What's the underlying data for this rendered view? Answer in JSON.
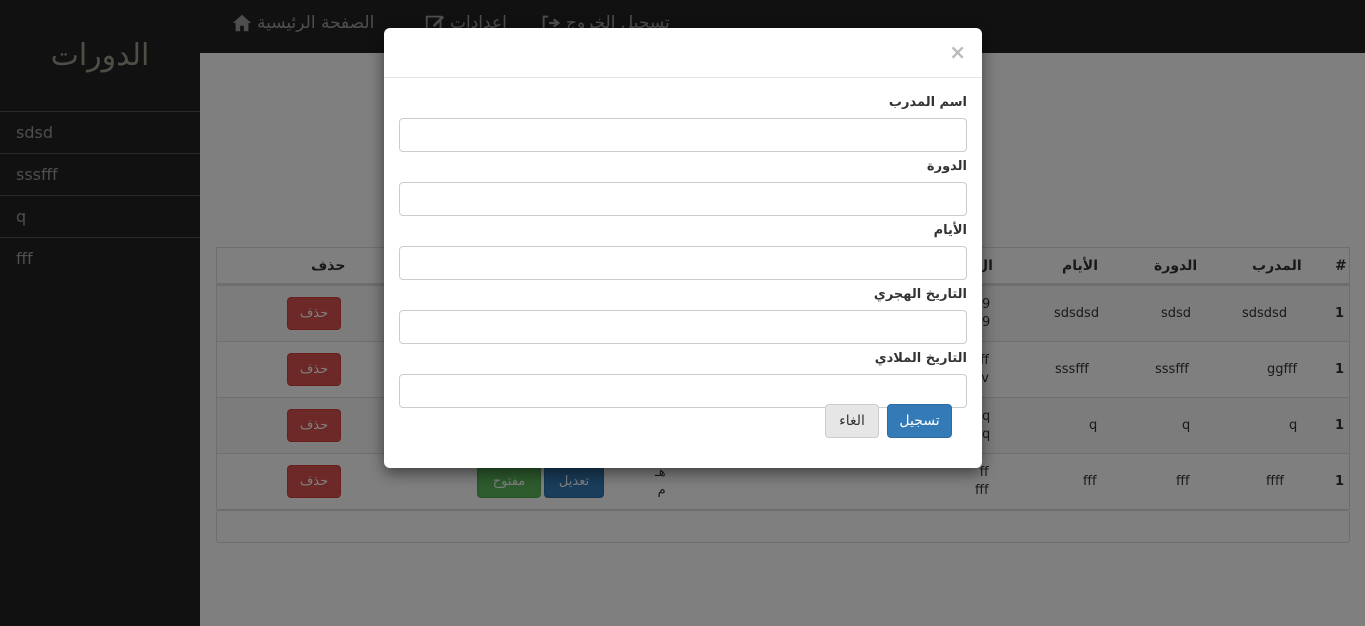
{
  "sidebar": {
    "title": "الدورات",
    "items": [
      {
        "label": "sdsd"
      },
      {
        "label": "sssfff"
      },
      {
        "label": "q"
      },
      {
        "label": "fff"
      }
    ]
  },
  "nav": {
    "home": "الصفحة الرئيسية",
    "settings": "اعدادات",
    "logout": "تسجيل الخروج"
  },
  "table": {
    "headers": {
      "num": "#",
      "trainer": "المدرب",
      "course": "الدورة",
      "days": "الأيام",
      "hijri": "ال",
      "delete": "حذف"
    },
    "rows": [
      {
        "num": "1",
        "trainer": "sdsdsd",
        "course": "sdsd",
        "days": "sdsdsd",
        "date1": "9",
        "date2": "9",
        "delete": "حذف"
      },
      {
        "num": "1",
        "trainer": "ggfff",
        "course": "sssfff",
        "days": "sssfff",
        "date1": "ff",
        "date2": "v",
        "delete": "حذف"
      },
      {
        "num": "1",
        "trainer": "q",
        "course": "q",
        "days": "q",
        "date1": "q",
        "date2": "q",
        "delete": "حذف"
      },
      {
        "num": "1",
        "trainer": "ffff",
        "course": "fff",
        "days": "fff",
        "date1": "ff",
        "date2": "fff",
        "meta1": "هـ",
        "meta2": "م",
        "edit": "تعديل",
        "open": "مفتوح",
        "delete": "حذف"
      }
    ]
  },
  "modal": {
    "close": "×",
    "fields": [
      {
        "label": "اسم المدرب",
        "value": ""
      },
      {
        "label": "الدورة",
        "value": ""
      },
      {
        "label": "الأيام",
        "value": ""
      },
      {
        "label": "التاريخ الهجري",
        "value": ""
      },
      {
        "label": "التاريخ الملادي",
        "value": ""
      }
    ],
    "submit": "تسجيل",
    "cancel": "الغاء"
  },
  "colors": {
    "danger": "#d9534f",
    "primary": "#337ab7",
    "success": "#5cb85c",
    "dark": "#222222"
  },
  "icons": {
    "home": "home-icon",
    "settings": "edit-icon",
    "logout": "sign-out-icon"
  }
}
